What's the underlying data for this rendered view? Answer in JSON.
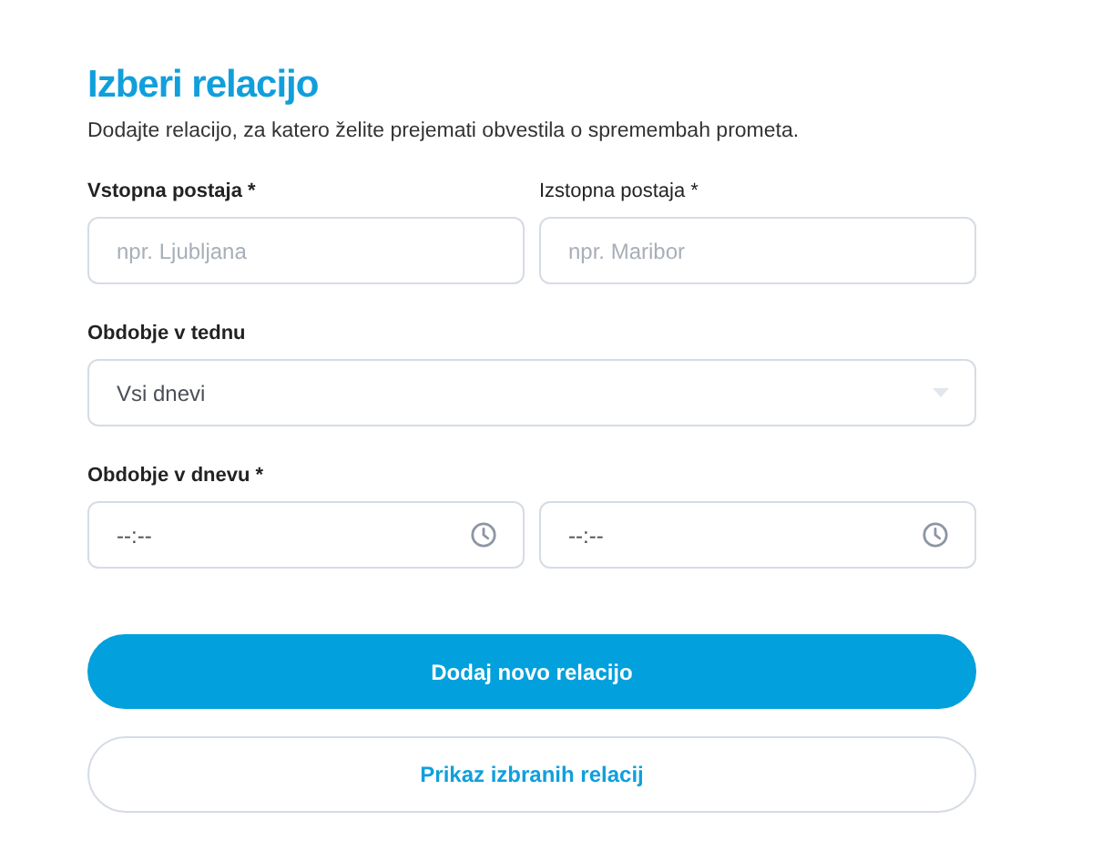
{
  "title": "Izberi relacijo",
  "subtitle": "Dodajte relacijo, za katero želite prejemati obvestila o spremembah prometa.",
  "stations": [
    {
      "label": "Vstopna postaja *",
      "bold": true,
      "placeholder": "npr. Ljubljana"
    },
    {
      "label": "Izstopna postaja *",
      "bold": false,
      "placeholder": "npr. Maribor"
    }
  ],
  "week_period": {
    "label": "Obdobje v tednu",
    "value": "Vsi dnevi"
  },
  "day_period": {
    "label": "Obdobje v dnevu *",
    "times": [
      {
        "value": "--:--"
      },
      {
        "value": "--:--"
      }
    ]
  },
  "buttons": [
    {
      "label": "Dodaj novo relacijo",
      "kind": "primary"
    },
    {
      "label": "Prikaz izbranih relacij",
      "kind": "secondary"
    }
  ]
}
